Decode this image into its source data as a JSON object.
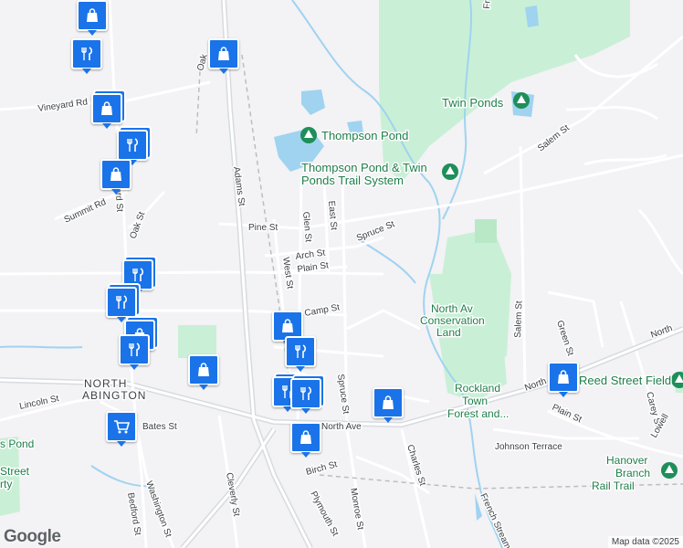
{
  "map": {
    "places": {
      "town": "NORTH ABINGTON",
      "parks": [
        "Twin Ponds",
        "Thompson Pond",
        "Thompson Pond & Twin Ponds Trail System",
        "North Av Conservation Land",
        "Reed Street Field",
        "Rockland Town Forest and...",
        "Hanover Branch Rail Trail",
        "Pond",
        "Street",
        "Party"
      ]
    },
    "roads": [
      "Adams St",
      "Vineyard Rd",
      "Bedford St",
      "Summit Rd",
      "Oak St",
      "Pine St",
      "Glen St",
      "East St",
      "Spruce St",
      "Arch St",
      "Plain St",
      "West St",
      "Camp St",
      "Lincoln St",
      "Bates St",
      "North Ave",
      "Washington St",
      "Cleverly St",
      "Birch St",
      "Plymouth St",
      "Monroe St",
      "Charles St",
      "Salem St",
      "Green St",
      "Carey St",
      "Lowell",
      "Johnson Terrace",
      "French Stream",
      "North",
      "Oak",
      "Fr"
    ],
    "pins": [
      {
        "id": "shopping-1",
        "icon": "shopping-bag-icon"
      },
      {
        "id": "restaurant-1",
        "icon": "restaurant-icon"
      },
      {
        "id": "shopping-2",
        "icon": "shopping-bag-icon"
      },
      {
        "id": "shopping-3",
        "icon": "shopping-bag-icon"
      },
      {
        "id": "restaurant-2",
        "icon": "restaurant-icon"
      },
      {
        "id": "shopping-4",
        "icon": "shopping-bag-icon"
      },
      {
        "id": "restaurant-3",
        "icon": "restaurant-icon"
      },
      {
        "id": "restaurant-4",
        "icon": "restaurant-icon"
      },
      {
        "id": "shopping-5",
        "icon": "shopping-bag-icon"
      },
      {
        "id": "restaurant-5",
        "icon": "restaurant-icon"
      },
      {
        "id": "shopping-6",
        "icon": "shopping-bag-icon"
      },
      {
        "id": "shopping-7",
        "icon": "shopping-bag-icon"
      },
      {
        "id": "restaurant-6",
        "icon": "restaurant-icon"
      },
      {
        "id": "restaurant-7",
        "icon": "restaurant-icon"
      },
      {
        "id": "shopping-8",
        "icon": "shopping-bag-icon"
      },
      {
        "id": "shopping-9",
        "icon": "shopping-bag-icon"
      },
      {
        "id": "grocery-1",
        "icon": "shopping-cart-icon"
      },
      {
        "id": "shopping-10",
        "icon": "shopping-bag-icon"
      }
    ],
    "colors": {
      "water": "#9fd3f0",
      "park": "#c9f0d6",
      "pin": "#1a73e8",
      "road": "#ffffff",
      "major_road": "#d7dbe0",
      "rail": "#bdbdbd"
    }
  },
  "attribution": {
    "logo": "Google",
    "text": "Map data ©2025"
  }
}
